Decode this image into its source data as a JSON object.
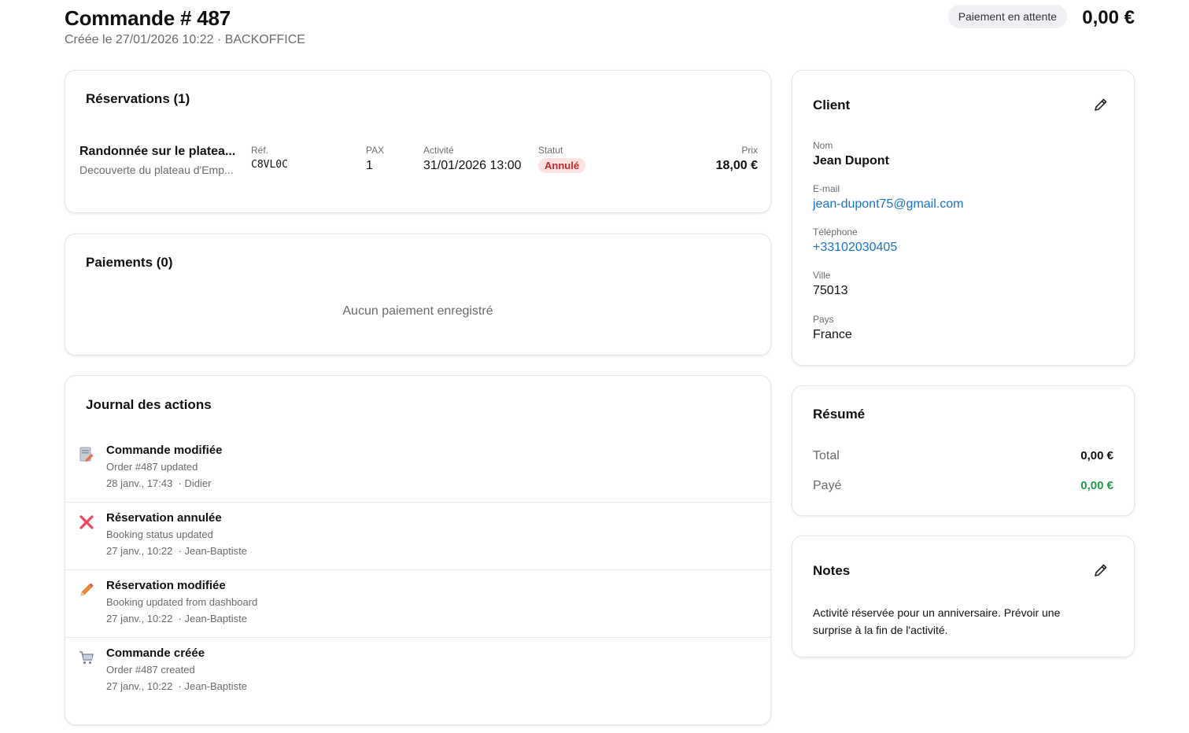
{
  "header": {
    "title": "Commande # 487",
    "subtitle": "Créée le 27/01/2026 10:22 · BACKOFFICE",
    "status": "Paiement en attente",
    "total": "0,00 €"
  },
  "reservations": {
    "title": "Réservations (1)",
    "columns": {
      "ref": "Réf.",
      "pax": "PAX",
      "activity": "Activité",
      "status": "Statut",
      "price": "Prix"
    },
    "items": [
      {
        "name": "Randonnée sur le platea...",
        "description": "Decouverte du plateau d'Emp...",
        "ref": "C8VL0C",
        "pax": "1",
        "activity": "31/01/2026 13:00",
        "status": "Annulé",
        "price": "18,00 €"
      }
    ]
  },
  "payments": {
    "title": "Paiements (0)",
    "empty": "Aucun paiement enregistré"
  },
  "journal": {
    "title": "Journal des actions",
    "items": [
      {
        "icon": "document-edit-icon",
        "title": "Commande modifiée",
        "description": "Order #487 updated",
        "meta": "28 janv., 17:43  · Didier"
      },
      {
        "icon": "cross-icon",
        "title": "Réservation annulée",
        "description": "Booking status updated",
        "meta": "27 janv., 10:22  · Jean-Baptiste"
      },
      {
        "icon": "pencil-icon",
        "title": "Réservation modifiée",
        "description": "Booking updated from dashboard",
        "meta": "27 janv., 10:22  · Jean-Baptiste"
      },
      {
        "icon": "cart-icon",
        "title": "Commande créée",
        "description": "Order #487 created",
        "meta": "27 janv., 10:22  · Jean-Baptiste"
      }
    ]
  },
  "client": {
    "title": "Client",
    "fields": {
      "name": {
        "label": "Nom",
        "value": "Jean Dupont"
      },
      "email": {
        "label": "E-mail",
        "value": "jean-dupont75@gmail.com"
      },
      "phone": {
        "label": "Téléphone",
        "value": "+33102030405"
      },
      "city": {
        "label": "Ville",
        "value": "75013"
      },
      "country": {
        "label": "Pays",
        "value": "France"
      }
    }
  },
  "summary": {
    "title": "Résumé",
    "total_label": "Total",
    "total_value": "0,00 €",
    "paid_label": "Payé",
    "paid_value": "0,00 €"
  },
  "notes": {
    "title": "Notes",
    "text": "Activité réservée pour un anniversaire. Prévoir une surprise à la fin de l'activité."
  },
  "colors": {
    "link": "#1a73c8",
    "paid": "#1e9e4a",
    "cancel_bg": "#fde2e2",
    "cancel_text": "#c62828",
    "pill_bg": "#eef0f3"
  }
}
